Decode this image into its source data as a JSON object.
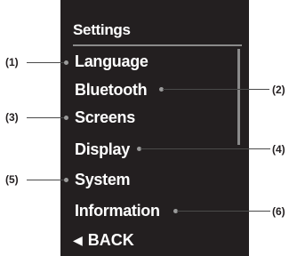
{
  "screen": {
    "title": "Settings",
    "items": [
      {
        "label": "Language"
      },
      {
        "label": "Bluetooth"
      },
      {
        "label": "Screens"
      },
      {
        "label": "Display"
      },
      {
        "label": "System"
      },
      {
        "label": "Information"
      }
    ],
    "back_label": "BACK"
  },
  "callouts": [
    "(1)",
    "(2)",
    "(3)",
    "(4)",
    "(5)",
    "(6)"
  ],
  "colors": {
    "screen_bg": "#231f20",
    "text": "#ffffff",
    "callout_line": "#4a4a4a"
  }
}
